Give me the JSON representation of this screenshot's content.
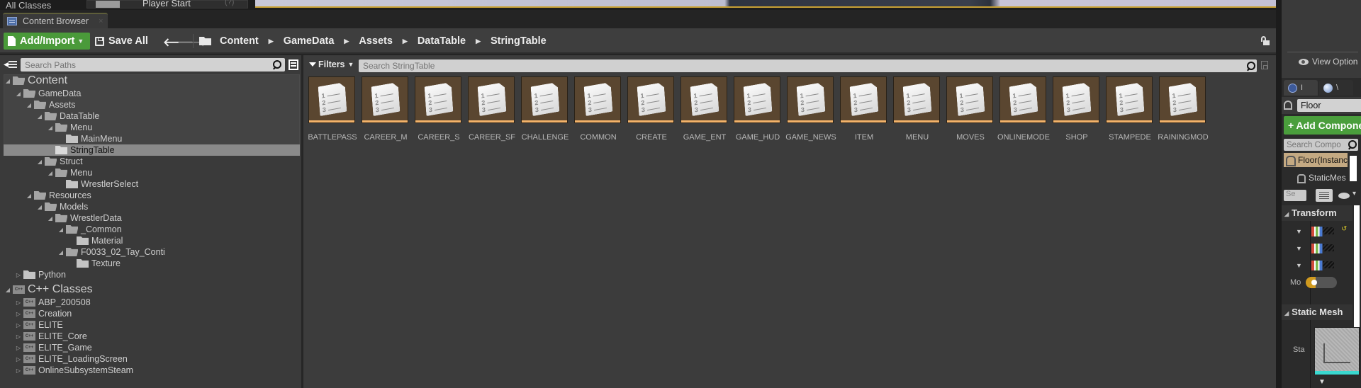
{
  "top_strip": {
    "left_label": "All Classes",
    "place_item_label": "Player Start",
    "place_item_help": "(?)"
  },
  "tab": {
    "label": "Content Browser",
    "close": "×",
    "icon": "content-browser-icon"
  },
  "toolbar": {
    "add_import_label": "Add/Import",
    "save_all_label": "Save All",
    "back_glyph": "🡐",
    "forward_glyph": "🡒",
    "breadcrumb": [
      "Content",
      "GameData",
      "Assets",
      "DataTable",
      "StringTable"
    ],
    "breadcrumb_separator": "▶",
    "lock_icon": "unlocked-padlock-icon"
  },
  "sources": {
    "search_placeholder": "Search Paths",
    "tree": [
      {
        "label": "Content",
        "depth": 0,
        "expanded": true,
        "type": "folder",
        "big": true
      },
      {
        "label": "GameData",
        "depth": 1,
        "expanded": true,
        "type": "folder"
      },
      {
        "label": "Assets",
        "depth": 2,
        "expanded": true,
        "type": "folder"
      },
      {
        "label": "DataTable",
        "depth": 3,
        "expanded": true,
        "type": "folder"
      },
      {
        "label": "Menu",
        "depth": 4,
        "expanded": true,
        "type": "folder"
      },
      {
        "label": "MainMenu",
        "depth": 5,
        "expanded": false,
        "type": "folder"
      },
      {
        "label": "StringTable",
        "depth": 4,
        "expanded": false,
        "type": "folder",
        "selected": true
      },
      {
        "label": "Struct",
        "depth": 3,
        "expanded": true,
        "type": "folder"
      },
      {
        "label": "Menu",
        "depth": 4,
        "expanded": true,
        "type": "folder"
      },
      {
        "label": "WrestlerSelect",
        "depth": 5,
        "expanded": false,
        "type": "folder"
      },
      {
        "label": "Resources",
        "depth": 2,
        "expanded": true,
        "type": "folder"
      },
      {
        "label": "Models",
        "depth": 3,
        "expanded": true,
        "type": "folder"
      },
      {
        "label": "WrestlerData",
        "depth": 4,
        "expanded": true,
        "type": "folder"
      },
      {
        "label": "_Common",
        "depth": 5,
        "expanded": true,
        "type": "folder"
      },
      {
        "label": "Material",
        "depth": 6,
        "expanded": false,
        "type": "folder"
      },
      {
        "label": "F0033_02_Tay_Conti",
        "depth": 5,
        "expanded": true,
        "type": "folder"
      },
      {
        "label": "Texture",
        "depth": 6,
        "expanded": false,
        "type": "folder"
      },
      {
        "label": "Python",
        "depth": 1,
        "expanded": false,
        "type": "folder",
        "collapsed_arrow": true
      },
      {
        "label": "C++ Classes",
        "depth": 0,
        "expanded": true,
        "type": "cpp",
        "big": true
      },
      {
        "label": "ABP_200508",
        "depth": 1,
        "expanded": false,
        "type": "cpp",
        "collapsed_arrow": true
      },
      {
        "label": "Creation",
        "depth": 1,
        "expanded": false,
        "type": "cpp",
        "collapsed_arrow": true
      },
      {
        "label": "ELITE",
        "depth": 1,
        "expanded": false,
        "type": "cpp",
        "collapsed_arrow": true
      },
      {
        "label": "ELITE_Core",
        "depth": 1,
        "expanded": false,
        "type": "cpp",
        "collapsed_arrow": true
      },
      {
        "label": "ELITE_Game",
        "depth": 1,
        "expanded": false,
        "type": "cpp",
        "collapsed_arrow": true
      },
      {
        "label": "ELITE_LoadingScreen",
        "depth": 1,
        "expanded": false,
        "type": "cpp",
        "collapsed_arrow": true
      },
      {
        "label": "OnlineSubsystemSteam",
        "depth": 1,
        "expanded": false,
        "type": "cpp",
        "collapsed_arrow": true
      }
    ]
  },
  "assets": {
    "filters_label": "Filters",
    "search_placeholder": "Search StringTable",
    "asset_type_color": "#f2b26a",
    "items": [
      "BATTLEPASS",
      "CAREER_M",
      "CAREER_S",
      "CAREER_SF",
      "CHALLENGE",
      "COMMON",
      "CREATE",
      "GAME_ENT",
      "GAME_HUD",
      "GAME_NEWS",
      "ITEM",
      "MENU",
      "MOVES",
      "ONLINEMODE",
      "SHOP",
      "STAMPEDE",
      "RAININGMOD"
    ]
  },
  "details": {
    "view_options_label": "View Option",
    "tabs": [
      {
        "label": "I",
        "icon": "details-info-icon"
      },
      {
        "label": "\\",
        "icon": "world-settings-globe-icon"
      }
    ],
    "actor_name": "Floor",
    "add_component_label": "+ Add Compone",
    "search_components_placeholder": "Search Compo",
    "components": [
      {
        "label": "Floor(Instanc",
        "root": true
      },
      {
        "label": "StaticMes",
        "root": false
      }
    ],
    "search_details_placeholder": "Se",
    "sections": [
      {
        "label": "Transform"
      },
      {
        "label": "Static Mesh"
      }
    ],
    "mobility_label": "Mo",
    "static_mesh_label": "Sta",
    "accent_green": "#4a9e3c",
    "selection_color": "#c4a982"
  }
}
